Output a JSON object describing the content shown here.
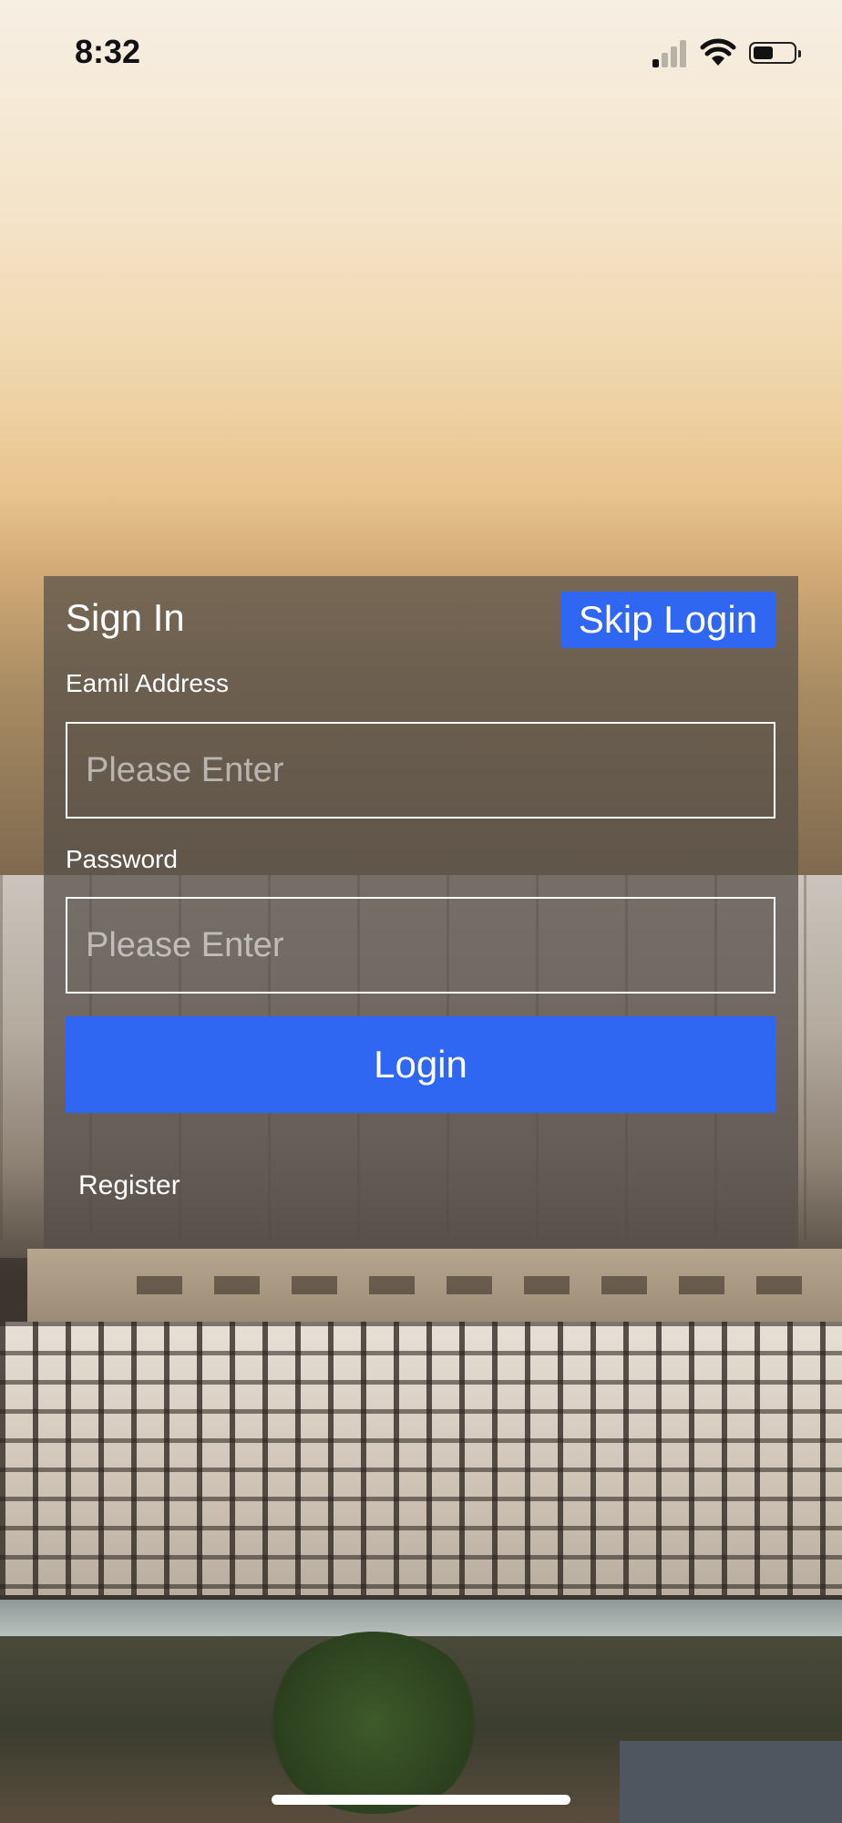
{
  "status_bar": {
    "time": "8:32",
    "signal_bars_active": 1,
    "signal_bars_total": 4,
    "battery_level": 0.5,
    "icons": [
      "signal-icon",
      "wifi-icon",
      "battery-icon"
    ]
  },
  "sign_in": {
    "title": "Sign In",
    "skip_label": "Skip Login",
    "email_label": "Eamil Address",
    "email_placeholder": "Please Enter",
    "email_value": "",
    "password_label": "Password",
    "password_placeholder": "Please Enter",
    "password_value": "",
    "login_label": "Login",
    "register_label": "Register"
  },
  "colors": {
    "accent": "#2f66f2",
    "panel_overlay": "#554e48",
    "text": "#ffffff"
  }
}
